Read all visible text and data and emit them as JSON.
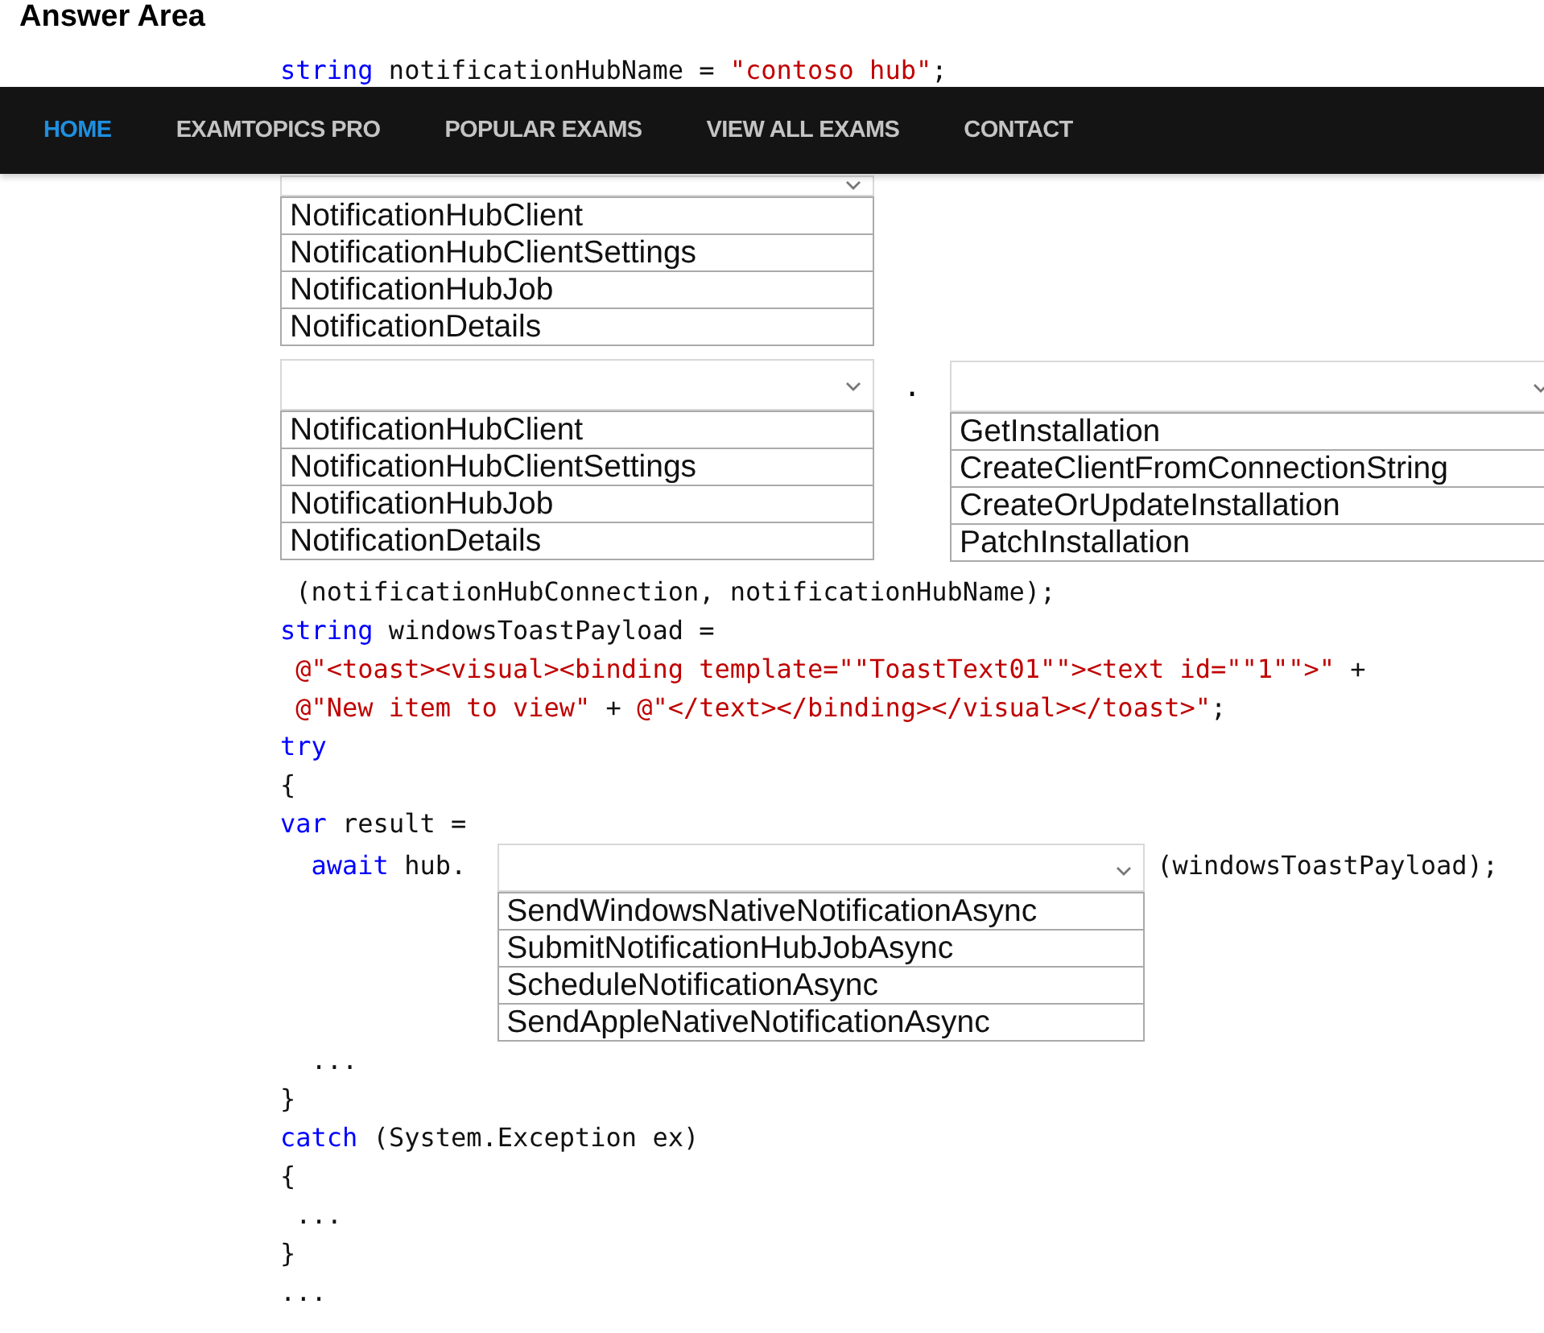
{
  "title": "Answer Area",
  "nav": [
    {
      "label": "HOME",
      "selected": true
    },
    {
      "label": "EXAMTOPICS PRO",
      "selected": false
    },
    {
      "label": "POPULAR EXAMS",
      "selected": false
    },
    {
      "label": "VIEW ALL EXAMS",
      "selected": false
    },
    {
      "label": "CONTACT",
      "selected": false
    }
  ],
  "blocks": [
    {
      "kind": "code",
      "tokens": [
        {
          "kind": "keyword",
          "text": "string"
        },
        {
          "kind": "plain",
          "text": " notificationHubName = "
        },
        {
          "kind": "string",
          "text": "\"contoso hub\""
        },
        {
          "kind": "plain",
          "text": ";"
        }
      ]
    },
    {
      "kind": "dropdowns",
      "dropdowns": [
        {
          "options": [
            "NotificationHubClient",
            "NotificationHubClientSettings",
            "NotificationHubJob",
            "NotificationDetails"
          ]
        }
      ]
    },
    {
      "kind": "dropdowns",
      "separator": ".",
      "dropdowns": [
        {
          "options": [
            "NotificationHubClient",
            "NotificationHubClientSettings",
            "NotificationHubJob",
            "NotificationDetails"
          ]
        },
        {
          "options": [
            "GetInstallation",
            "CreateClientFromConnectionString",
            "CreateOrUpdateInstallation",
            "PatchInstallation"
          ]
        }
      ]
    },
    {
      "kind": "code",
      "tokens": [
        {
          "kind": "plain",
          "text": " (notificationHubConnection, notificationHubName);"
        }
      ]
    },
    {
      "kind": "code",
      "tokens": [
        {
          "kind": "keyword",
          "text": "string"
        },
        {
          "kind": "plain",
          "text": " windowsToastPayload ="
        }
      ]
    },
    {
      "kind": "code",
      "tokens": [
        {
          "kind": "string",
          "text": " @\"<toast><visual><binding template=\"\"ToastText01\"\"><text id=\"\"1\"\">\""
        },
        {
          "kind": "plain",
          "text": " +"
        }
      ]
    },
    {
      "kind": "code",
      "tokens": [
        {
          "kind": "string",
          "text": " @\"New item to view\""
        },
        {
          "kind": "plain",
          "text": " + "
        },
        {
          "kind": "string",
          "text": "@\"</text></binding></visual></toast>\""
        },
        {
          "kind": "plain",
          "text": ";"
        }
      ]
    },
    {
      "kind": "code",
      "tokens": [
        {
          "kind": "keyword",
          "text": "try"
        }
      ]
    },
    {
      "kind": "code",
      "tokens": [
        {
          "kind": "plain",
          "text": "{"
        }
      ]
    },
    {
      "kind": "code",
      "tokens": [
        {
          "kind": "keyword",
          "text": "var"
        },
        {
          "kind": "plain",
          "text": " result ="
        }
      ]
    },
    {
      "kind": "inline_dropdown",
      "before": [
        {
          "kind": "keyword",
          "text": "  await"
        },
        {
          "kind": "plain",
          "text": " hub."
        }
      ],
      "after": [
        {
          "kind": "plain",
          "text": "(windowsToastPayload);"
        }
      ],
      "options": [
        "SendWindowsNativeNotificationAsync",
        "SubmitNotificationHubJobAsync",
        "ScheduleNotificationAsync",
        "SendAppleNativeNotificationAsync"
      ]
    },
    {
      "kind": "code",
      "tokens": [
        {
          "kind": "plain",
          "text": "  ..."
        }
      ]
    },
    {
      "kind": "code",
      "tokens": [
        {
          "kind": "plain",
          "text": "}"
        }
      ]
    },
    {
      "kind": "code",
      "tokens": [
        {
          "kind": "keyword",
          "text": "catch"
        },
        {
          "kind": "plain",
          "text": " (System.Exception ex)"
        }
      ]
    },
    {
      "kind": "code",
      "tokens": [
        {
          "kind": "plain",
          "text": "{"
        }
      ]
    },
    {
      "kind": "code",
      "tokens": [
        {
          "kind": "plain",
          "text": " ..."
        }
      ]
    },
    {
      "kind": "code",
      "tokens": [
        {
          "kind": "plain",
          "text": "}"
        }
      ]
    },
    {
      "kind": "code",
      "tokens": [
        {
          "kind": "plain",
          "text": "..."
        }
      ]
    }
  ]
}
